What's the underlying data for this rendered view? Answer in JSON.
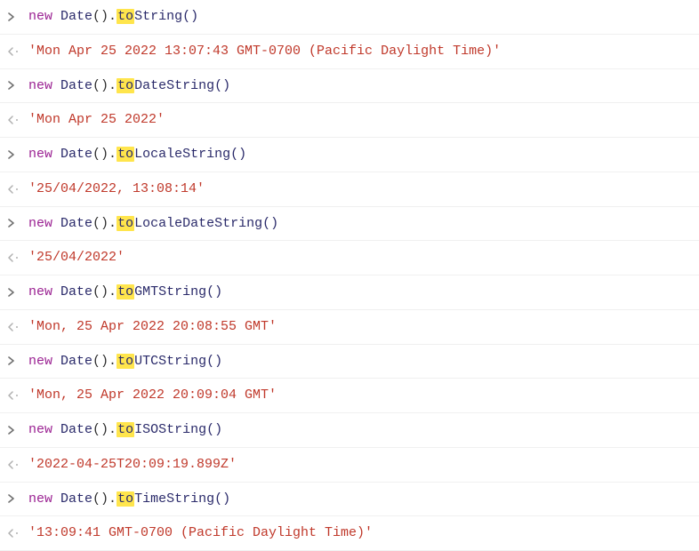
{
  "console": {
    "entries": [
      {
        "input": {
          "kw": "new",
          "obj": "Date",
          "parens1": "().",
          "hl": "to",
          "rest": "String()"
        },
        "output": "'Mon Apr 25 2022 13:07:43 GMT-0700 (Pacific Daylight Time)'"
      },
      {
        "input": {
          "kw": "new",
          "obj": "Date",
          "parens1": "().",
          "hl": "to",
          "rest": "DateString()"
        },
        "output": "'Mon Apr 25 2022'"
      },
      {
        "input": {
          "kw": "new",
          "obj": "Date",
          "parens1": "().",
          "hl": "to",
          "rest": "LocaleString()"
        },
        "output": "'25/04/2022, 13:08:14'"
      },
      {
        "input": {
          "kw": "new",
          "obj": "Date",
          "parens1": "().",
          "hl": "to",
          "rest": "LocaleDateString()"
        },
        "output": "'25/04/2022'"
      },
      {
        "input": {
          "kw": "new",
          "obj": "Date",
          "parens1": "().",
          "hl": "to",
          "rest": "GMTString()"
        },
        "output": "'Mon, 25 Apr 2022 20:08:55 GMT'"
      },
      {
        "input": {
          "kw": "new",
          "obj": "Date",
          "parens1": "().",
          "hl": "to",
          "rest": "UTCString()"
        },
        "output": "'Mon, 25 Apr 2022 20:09:04 GMT'"
      },
      {
        "input": {
          "kw": "new",
          "obj": "Date",
          "parens1": "().",
          "hl": "to",
          "rest": "ISOString()"
        },
        "output": "'2022-04-25T20:09:19.899Z'"
      },
      {
        "input": {
          "kw": "new",
          "obj": "Date",
          "parens1": "().",
          "hl": "to",
          "rest": "TimeString()"
        },
        "output": "'13:09:41 GMT-0700 (Pacific Daylight Time)'"
      }
    ]
  }
}
